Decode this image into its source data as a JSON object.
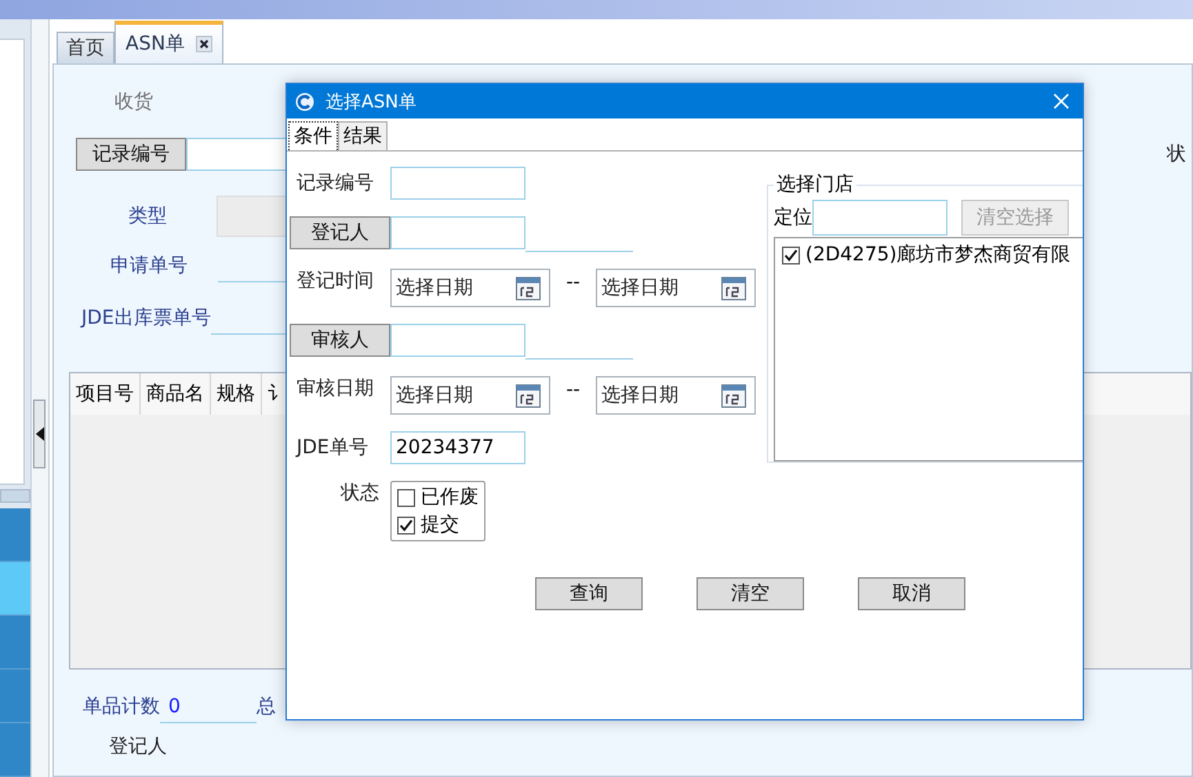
{
  "app_tabs": [
    {
      "label": "首页",
      "selected": false,
      "closable": false
    },
    {
      "label": "ASN单",
      "selected": true,
      "closable": true
    }
  ],
  "sidebar_rows": [
    {
      "selected": false
    },
    {
      "selected": true
    },
    {
      "selected": false
    },
    {
      "selected": false
    },
    {
      "selected": false
    }
  ],
  "form": {
    "section": "收货",
    "record_button": "记录编号",
    "status_label": "状",
    "type_label": "类型",
    "request_label": "申请单号",
    "jde_label": "JDE出库票单号"
  },
  "table": {
    "columns": [
      "项目号",
      "商品名",
      "规格",
      "讠"
    ]
  },
  "footer": {
    "count_label": "单品计数",
    "count_value": "0",
    "total_label": "总",
    "registrar_label": "登记人"
  },
  "dialog": {
    "title": "选择ASN单",
    "tabs": [
      {
        "label": "条件",
        "selected": true
      },
      {
        "label": "结果",
        "selected": false
      }
    ],
    "fields": [
      {
        "kind": "text",
        "label": "记录编号"
      },
      {
        "kind": "lookup",
        "label": "登记人"
      },
      {
        "kind": "daterange",
        "label": "登记时间",
        "from": "选择日期",
        "separator": "--",
        "to": "选择日期"
      },
      {
        "kind": "lookup",
        "label": "审核人"
      },
      {
        "kind": "daterange",
        "label": "审核日期",
        "from": "选择日期",
        "separator": "--",
        "to": "选择日期"
      },
      {
        "kind": "text",
        "label": "JDE单号",
        "value": "20234377"
      },
      {
        "kind": "checks",
        "label": "状态",
        "options": [
          {
            "label": "已作废",
            "checked": false
          },
          {
            "label": "提交",
            "checked": true
          }
        ]
      }
    ],
    "store_group": {
      "title": "选择门店",
      "locate_label": "定位",
      "clear_button": "清空选择",
      "stores": [
        {
          "label": "(2D4275)廊坊市梦杰商贸有限",
          "checked": true
        }
      ]
    },
    "buttons": [
      "查询",
      "清空",
      "取消"
    ]
  }
}
